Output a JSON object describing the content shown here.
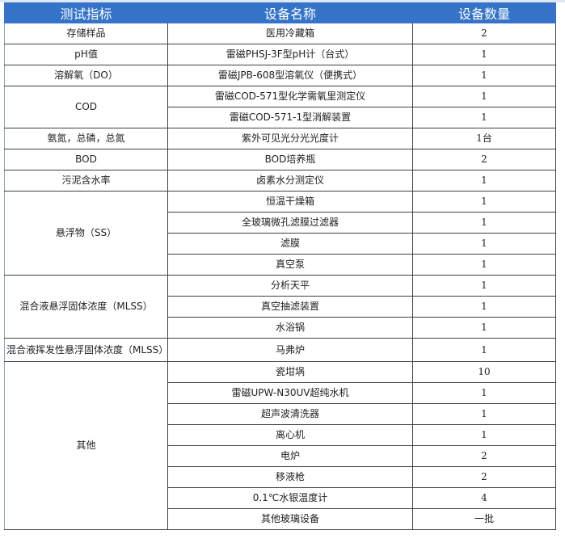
{
  "table": {
    "headers": [
      "测试指标",
      "设备名称",
      "设备数量"
    ],
    "groups": [
      {
        "metric": "存储样品",
        "items": [
          {
            "name": "医用冷藏箱",
            "qty": "2"
          }
        ]
      },
      {
        "metric": "pH值",
        "items": [
          {
            "name": "雷磁PHSJ-3F型pH计（台式）",
            "qty": "1"
          }
        ]
      },
      {
        "metric": "溶解氧（DO）",
        "items": [
          {
            "name": "雷磁JPB-608型溶氧仪（便携式）",
            "qty": "1"
          }
        ]
      },
      {
        "metric": "COD",
        "items": [
          {
            "name": "雷磁COD-571型化学需氧里测定仪",
            "qty": "1"
          },
          {
            "name": "雷磁COD-571-1型消解装置",
            "qty": "1"
          }
        ]
      },
      {
        "metric": "氨氮，总磷，总氮",
        "items": [
          {
            "name": "紫外可见光分光光度计",
            "qty": "1台"
          }
        ]
      },
      {
        "metric": "BOD",
        "items": [
          {
            "name": "BOD培养瓶",
            "qty": "2"
          }
        ]
      },
      {
        "metric": "污泥含水率",
        "items": [
          {
            "name": "卤素水分测定仪",
            "qty": "1"
          }
        ]
      },
      {
        "metric": "悬浮物（SS）",
        "items": [
          {
            "name": "恒温干燥箱",
            "qty": "1"
          },
          {
            "name": "全玻璃微孔滤膜过滤器",
            "qty": "1"
          },
          {
            "name": "滤膜",
            "qty": "1"
          },
          {
            "name": "真空泵",
            "qty": "1"
          }
        ]
      },
      {
        "metric": "混合液悬浮固体浓度（MLSS）",
        "items": [
          {
            "name": "分析天平",
            "qty": "1"
          },
          {
            "name": "真空抽滤装置",
            "qty": "1"
          },
          {
            "name": "水浴锅",
            "qty": "1"
          }
        ]
      },
      {
        "metric": "混合液挥发性悬浮固体浓度（MLSS）",
        "items": [
          {
            "name": "马弗炉",
            "qty": "1"
          }
        ]
      },
      {
        "metric": "其他",
        "items": [
          {
            "name": "瓷坩埚",
            "qty": "10"
          },
          {
            "name": "雷磁UPW-N30UV超纯水机",
            "qty": "1"
          },
          {
            "name": "超声波清洗器",
            "qty": "1"
          },
          {
            "name": "离心机",
            "qty": "1"
          },
          {
            "name": "电炉",
            "qty": "2"
          },
          {
            "name": "移液枪",
            "qty": "2"
          },
          {
            "name": "0.1℃水银温度计",
            "qty": "4"
          },
          {
            "name": "其他玻璃设备",
            "qty": "一批"
          }
        ]
      }
    ]
  },
  "colors": {
    "header_bg": "#3473c8",
    "header_text": "#ffffff",
    "border": "#404040"
  }
}
